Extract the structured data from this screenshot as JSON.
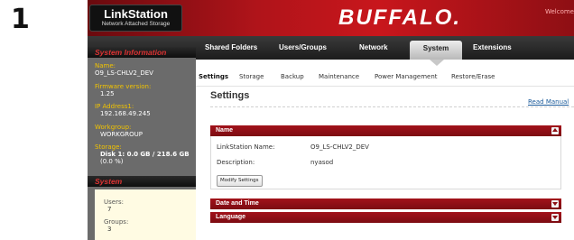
{
  "step_number": "1",
  "header": {
    "logo_title": "LinkStation",
    "logo_subtitle": "Network Attached Storage",
    "brand": "BUFFALO.",
    "welcome": "Welcome"
  },
  "nav": {
    "items": [
      "Shared Folders",
      "Users/Groups",
      "Network",
      "System",
      "Extensions"
    ],
    "active": "System"
  },
  "subnav": {
    "items": [
      "Settings",
      "Storage",
      "Backup",
      "Maintenance",
      "Power Management",
      "Restore/Erase"
    ],
    "active": "Settings"
  },
  "sidebar": {
    "system_info_title": "System Information",
    "name_label": "Name:",
    "name_value": "O9_LS-CHLV2_DEV",
    "firmware_label": "Firmware version:",
    "firmware_value": "1.25",
    "ip_label": "IP Address1:",
    "ip_value": "192.168.49.245",
    "workgroup_label": "Workgroup:",
    "workgroup_value": "WORKGROUP",
    "storage_label": "Storage:",
    "storage_value": "Disk 1: 0.0 GB / 218.6 GB",
    "storage_percent": "(0.0 %)",
    "system_title": "System",
    "users_label": "Users:",
    "users_value": "7",
    "groups_label": "Groups:",
    "groups_value": "3"
  },
  "main": {
    "title": "Settings",
    "read_manual": "Read Manual",
    "name_panel": {
      "title": "Name",
      "linkstation_name_label": "LinkStation Name:",
      "linkstation_name_value": "O9_LS-CHLV2_DEV",
      "description_label": "Description:",
      "description_value": "nyasod",
      "modify_button": "Modify Settings"
    },
    "date_time_panel": {
      "title": "Date and Time"
    },
    "language_panel": {
      "title": "Language"
    }
  },
  "colors": {
    "header_red": "#c8161c",
    "panel_red": "#8e0f14",
    "sidebar_gray": "#6b6b6b",
    "label_yellow": "#f2c300"
  }
}
